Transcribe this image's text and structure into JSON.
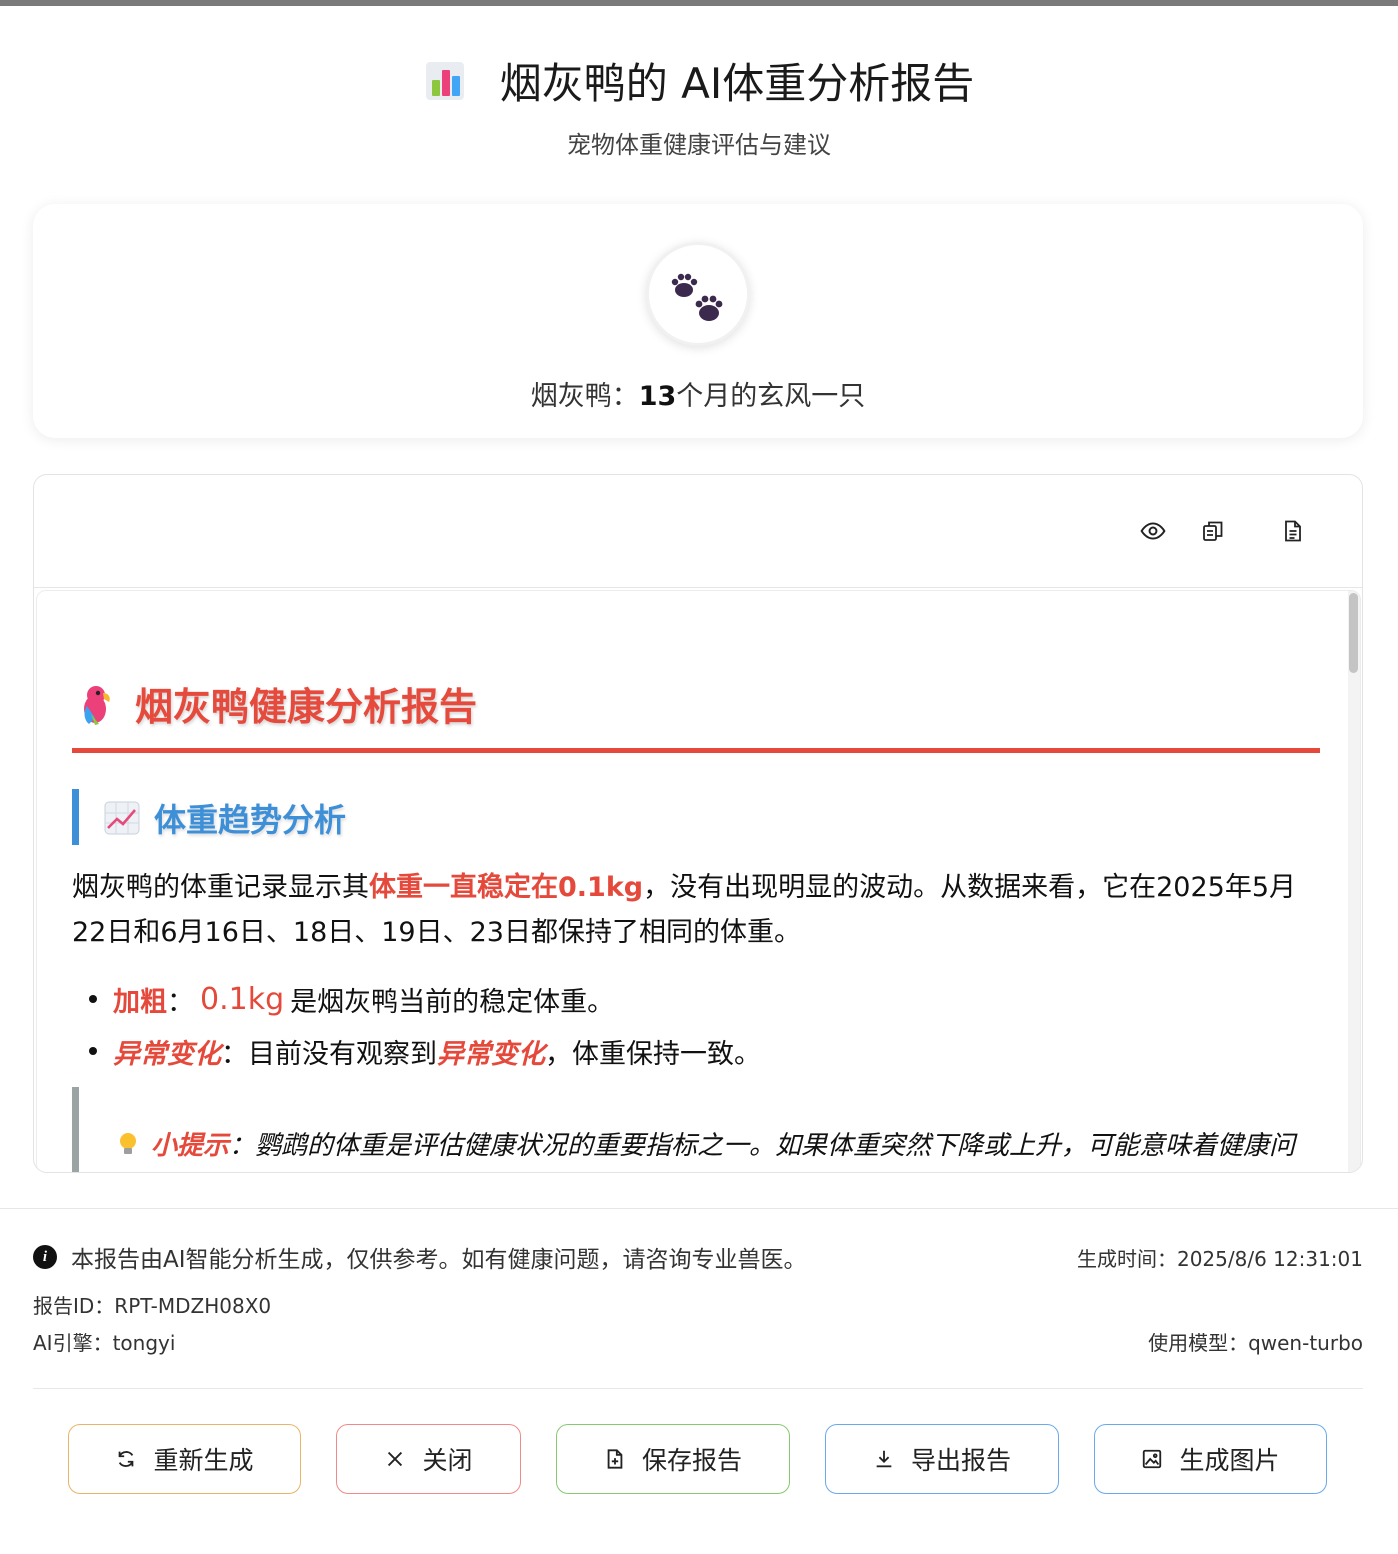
{
  "header": {
    "title": "烟灰鸭的 AI体重分析报告",
    "subtitle": "宠物体重健康评估与建议",
    "icon": "bar-chart-emoji"
  },
  "pet": {
    "name_label": "烟灰鸭：",
    "age": "13",
    "description": "个月的玄风一只",
    "avatar_icon": "paw-prints-icon"
  },
  "toolbar": {
    "icons": [
      "eye-icon",
      "copy-icon",
      "document-icon"
    ]
  },
  "report": {
    "title": "烟灰鸭健康分析报告",
    "section_title": "体重趋势分析",
    "paragraph_1": "烟灰鸭的体重记录显示其",
    "paragraph_highlight": "体重一直稳定在0.1kg",
    "paragraph_2": "，没有出现明显的波动。从数据来看，它在2025年5月22日和6月16日、18日、19日、23日都保持了相同的体重。",
    "bullets": [
      {
        "label": "加粗",
        "sep": "：",
        "value": "0.1kg",
        "text": "是烟灰鸭当前的稳定体重。"
      },
      {
        "label": "异常变化",
        "sep": "：",
        "text_before": "目前没有观察到",
        "emphasis": "异常变化",
        "text_after": "，体重保持一致。"
      }
    ],
    "tip_label": "小提示",
    "tip_text": "：鹦鹉的体重是评估健康状况的重要指标之一。如果体重突然下降或上升，可能意味着健康问"
  },
  "footer": {
    "disclaimer": "本报告由AI智能分析生成，仅供参考。如有健康问题，请咨询专业兽医。",
    "generated_time": "生成时间：2025/8/6 12:31:01",
    "report_id": "报告ID：RPT-MDZH08X0",
    "ai_engine": "AI引擎：tongyi",
    "model": "使用模型：qwen-turbo"
  },
  "buttons": {
    "regenerate": "重新生成",
    "close": "关闭",
    "save": "保存报告",
    "export": "导出报告",
    "image": "生成图片"
  },
  "colors": {
    "accent_red": "#e5493b",
    "accent_blue": "#3d8fd8",
    "regenerate_border": "#e8b468",
    "close_border": "#f08a8a",
    "save_border": "#86c96e",
    "export_border": "#6aa9ea",
    "image_border": "#6aa9ea"
  }
}
